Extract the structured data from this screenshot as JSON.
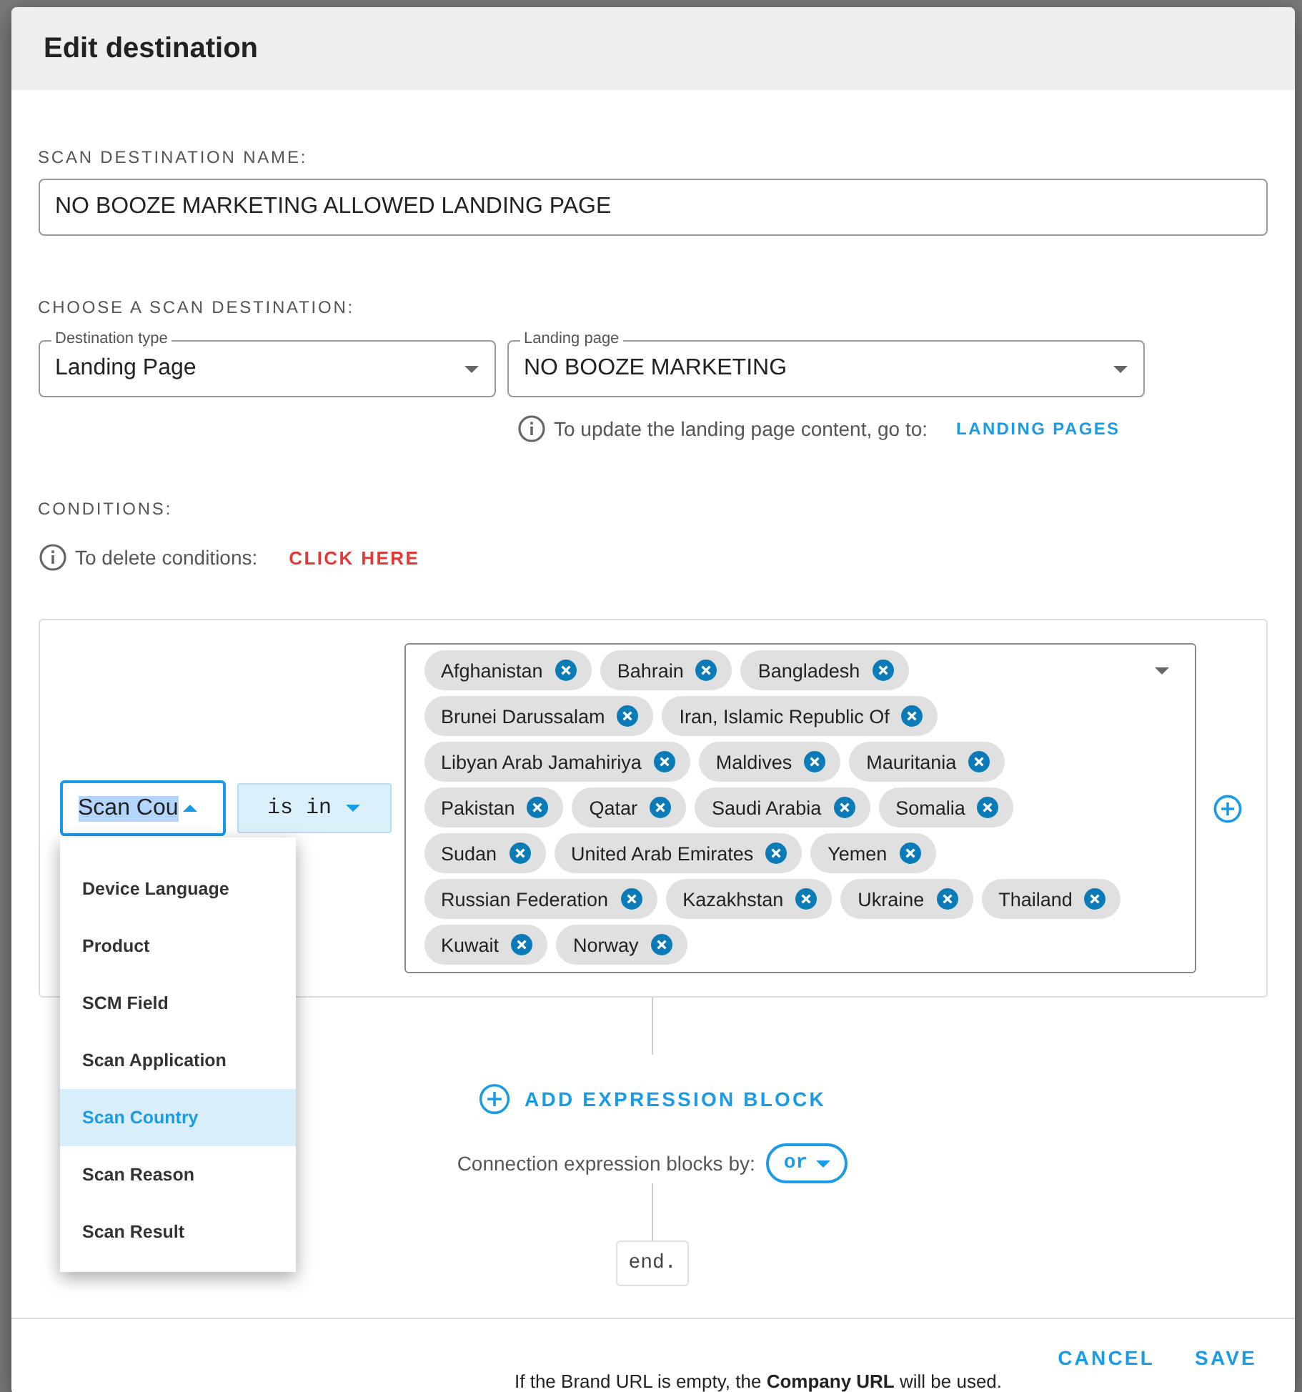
{
  "dialog": {
    "title": "Edit destination"
  },
  "name_field": {
    "label": "SCAN DESTINATION NAME:",
    "value": "NO BOOZE MARKETING ALLOWED LANDING PAGE"
  },
  "destination": {
    "label": "CHOOSE A SCAN DESTINATION:",
    "type_select": {
      "label": "Destination type",
      "value": "Landing Page"
    },
    "page_select": {
      "label": "Landing page",
      "value": "NO BOOZE MARKETING"
    },
    "hint": "To update the landing page content, go to:",
    "link": "LANDING PAGES"
  },
  "conditions": {
    "label": "CONDITIONS:",
    "hint": "To delete conditions:",
    "link": "CLICK HERE"
  },
  "expression": {
    "field_select": {
      "value": "Scan Cou",
      "expanded": true
    },
    "operator": {
      "value": "is in"
    },
    "values": [
      "Afghanistan",
      "Bahrain",
      "Bangladesh",
      "Brunei Darussalam",
      "Iran, Islamic Republic Of",
      "Libyan Arab Jamahiriya",
      "Maldives",
      "Mauritania",
      "Pakistan",
      "Qatar",
      "Saudi Arabia",
      "Somalia",
      "Sudan",
      "United Arab Emirates",
      "Yemen",
      "Russian Federation",
      "Kazakhstan",
      "Ukraine",
      "Thailand",
      "Kuwait",
      "Norway"
    ],
    "menu": [
      {
        "label": "Device Language",
        "selected": false
      },
      {
        "label": "Product",
        "selected": false
      },
      {
        "label": "SCM Field",
        "selected": false
      },
      {
        "label": "Scan Application",
        "selected": false
      },
      {
        "label": "Scan Country",
        "selected": true
      },
      {
        "label": "Scan Reason",
        "selected": false
      },
      {
        "label": "Scan Result",
        "selected": false
      }
    ]
  },
  "add_block": "ADD EXPRESSION BLOCK",
  "connector": {
    "label": "Connection expression blocks by:",
    "value": "or"
  },
  "end": "end.",
  "actions": [
    {
      "label": "CANCEL"
    },
    {
      "label": "SAVE"
    }
  ],
  "background_text": "If the Brand URL is empty, the **Company URL** will be used."
}
